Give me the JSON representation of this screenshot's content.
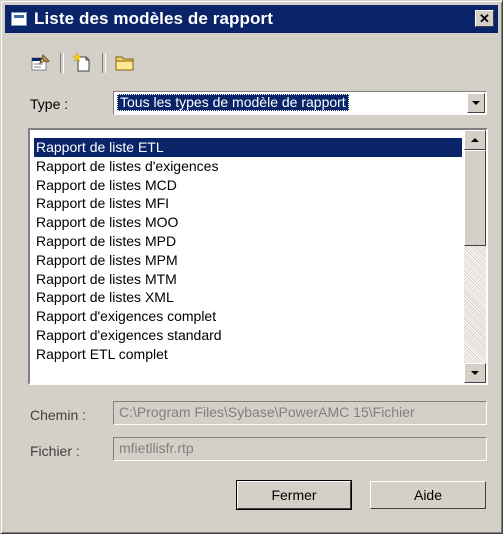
{
  "window": {
    "title": "Liste des modèles de rapport",
    "close_label": "✕"
  },
  "toolbar": {
    "icons": [
      "properties-icon",
      "new-icon",
      "open-folder-icon"
    ]
  },
  "type_filter": {
    "label": "Type :",
    "value": "Tous les types de modèle de rapport"
  },
  "templates": {
    "selected_index": 0,
    "items": [
      "Rapport de liste ETL",
      "Rapport de listes d'exigences",
      "Rapport de listes MCD",
      "Rapport de listes MFI",
      "Rapport de listes MOO",
      "Rapport de listes MPD",
      "Rapport de listes MPM",
      "Rapport de listes MTM",
      "Rapport de listes XML",
      "Rapport d'exigences complet",
      "Rapport d'exigences standard",
      "Rapport ETL complet"
    ]
  },
  "path": {
    "label": "Chemin :",
    "value": "C:\\Program Files\\Sybase\\PowerAMC 15\\Fichier"
  },
  "file": {
    "label": "Fichier :",
    "value": "mfietllisfr.rtp"
  },
  "buttons": {
    "close": "Fermer",
    "help": "Aide"
  },
  "colors": {
    "titlebar": "#0a246a",
    "dialog_bg": "#d4d0c8",
    "selection": "#0a246a"
  }
}
